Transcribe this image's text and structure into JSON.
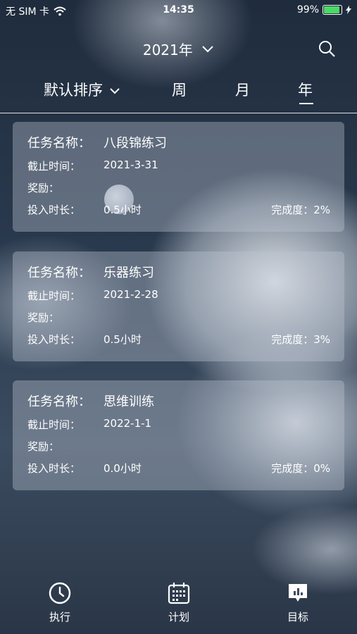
{
  "status_bar": {
    "carrier": "无 SIM 卡",
    "time": "14:35",
    "battery": "99%"
  },
  "header": {
    "year": "2021年"
  },
  "filters": {
    "sort": "默认排序",
    "tabs": [
      "周",
      "月",
      "年"
    ],
    "active_tab": "年"
  },
  "field_labels": {
    "task_name": "任务名称：",
    "deadline": "截止时间：",
    "reward": "奖励：",
    "hours": "投入时长：",
    "progress": "完成度："
  },
  "tasks": [
    {
      "name": "八段锦练习",
      "deadline": "2021-3-31",
      "reward": "",
      "hours": "0.5小时",
      "progress": "2%"
    },
    {
      "name": "乐器练习",
      "deadline": "2021-2-28",
      "reward": "",
      "hours": "0.5小时",
      "progress": "3%"
    },
    {
      "name": "思维训练",
      "deadline": "2022-1-1",
      "reward": "",
      "hours": "0.0小时",
      "progress": "0%"
    }
  ],
  "nav": {
    "items": [
      {
        "label": "执行",
        "icon": "clock-icon"
      },
      {
        "label": "计划",
        "icon": "calendar-icon"
      },
      {
        "label": "目标",
        "icon": "chart-icon"
      }
    ],
    "active": "目标"
  }
}
